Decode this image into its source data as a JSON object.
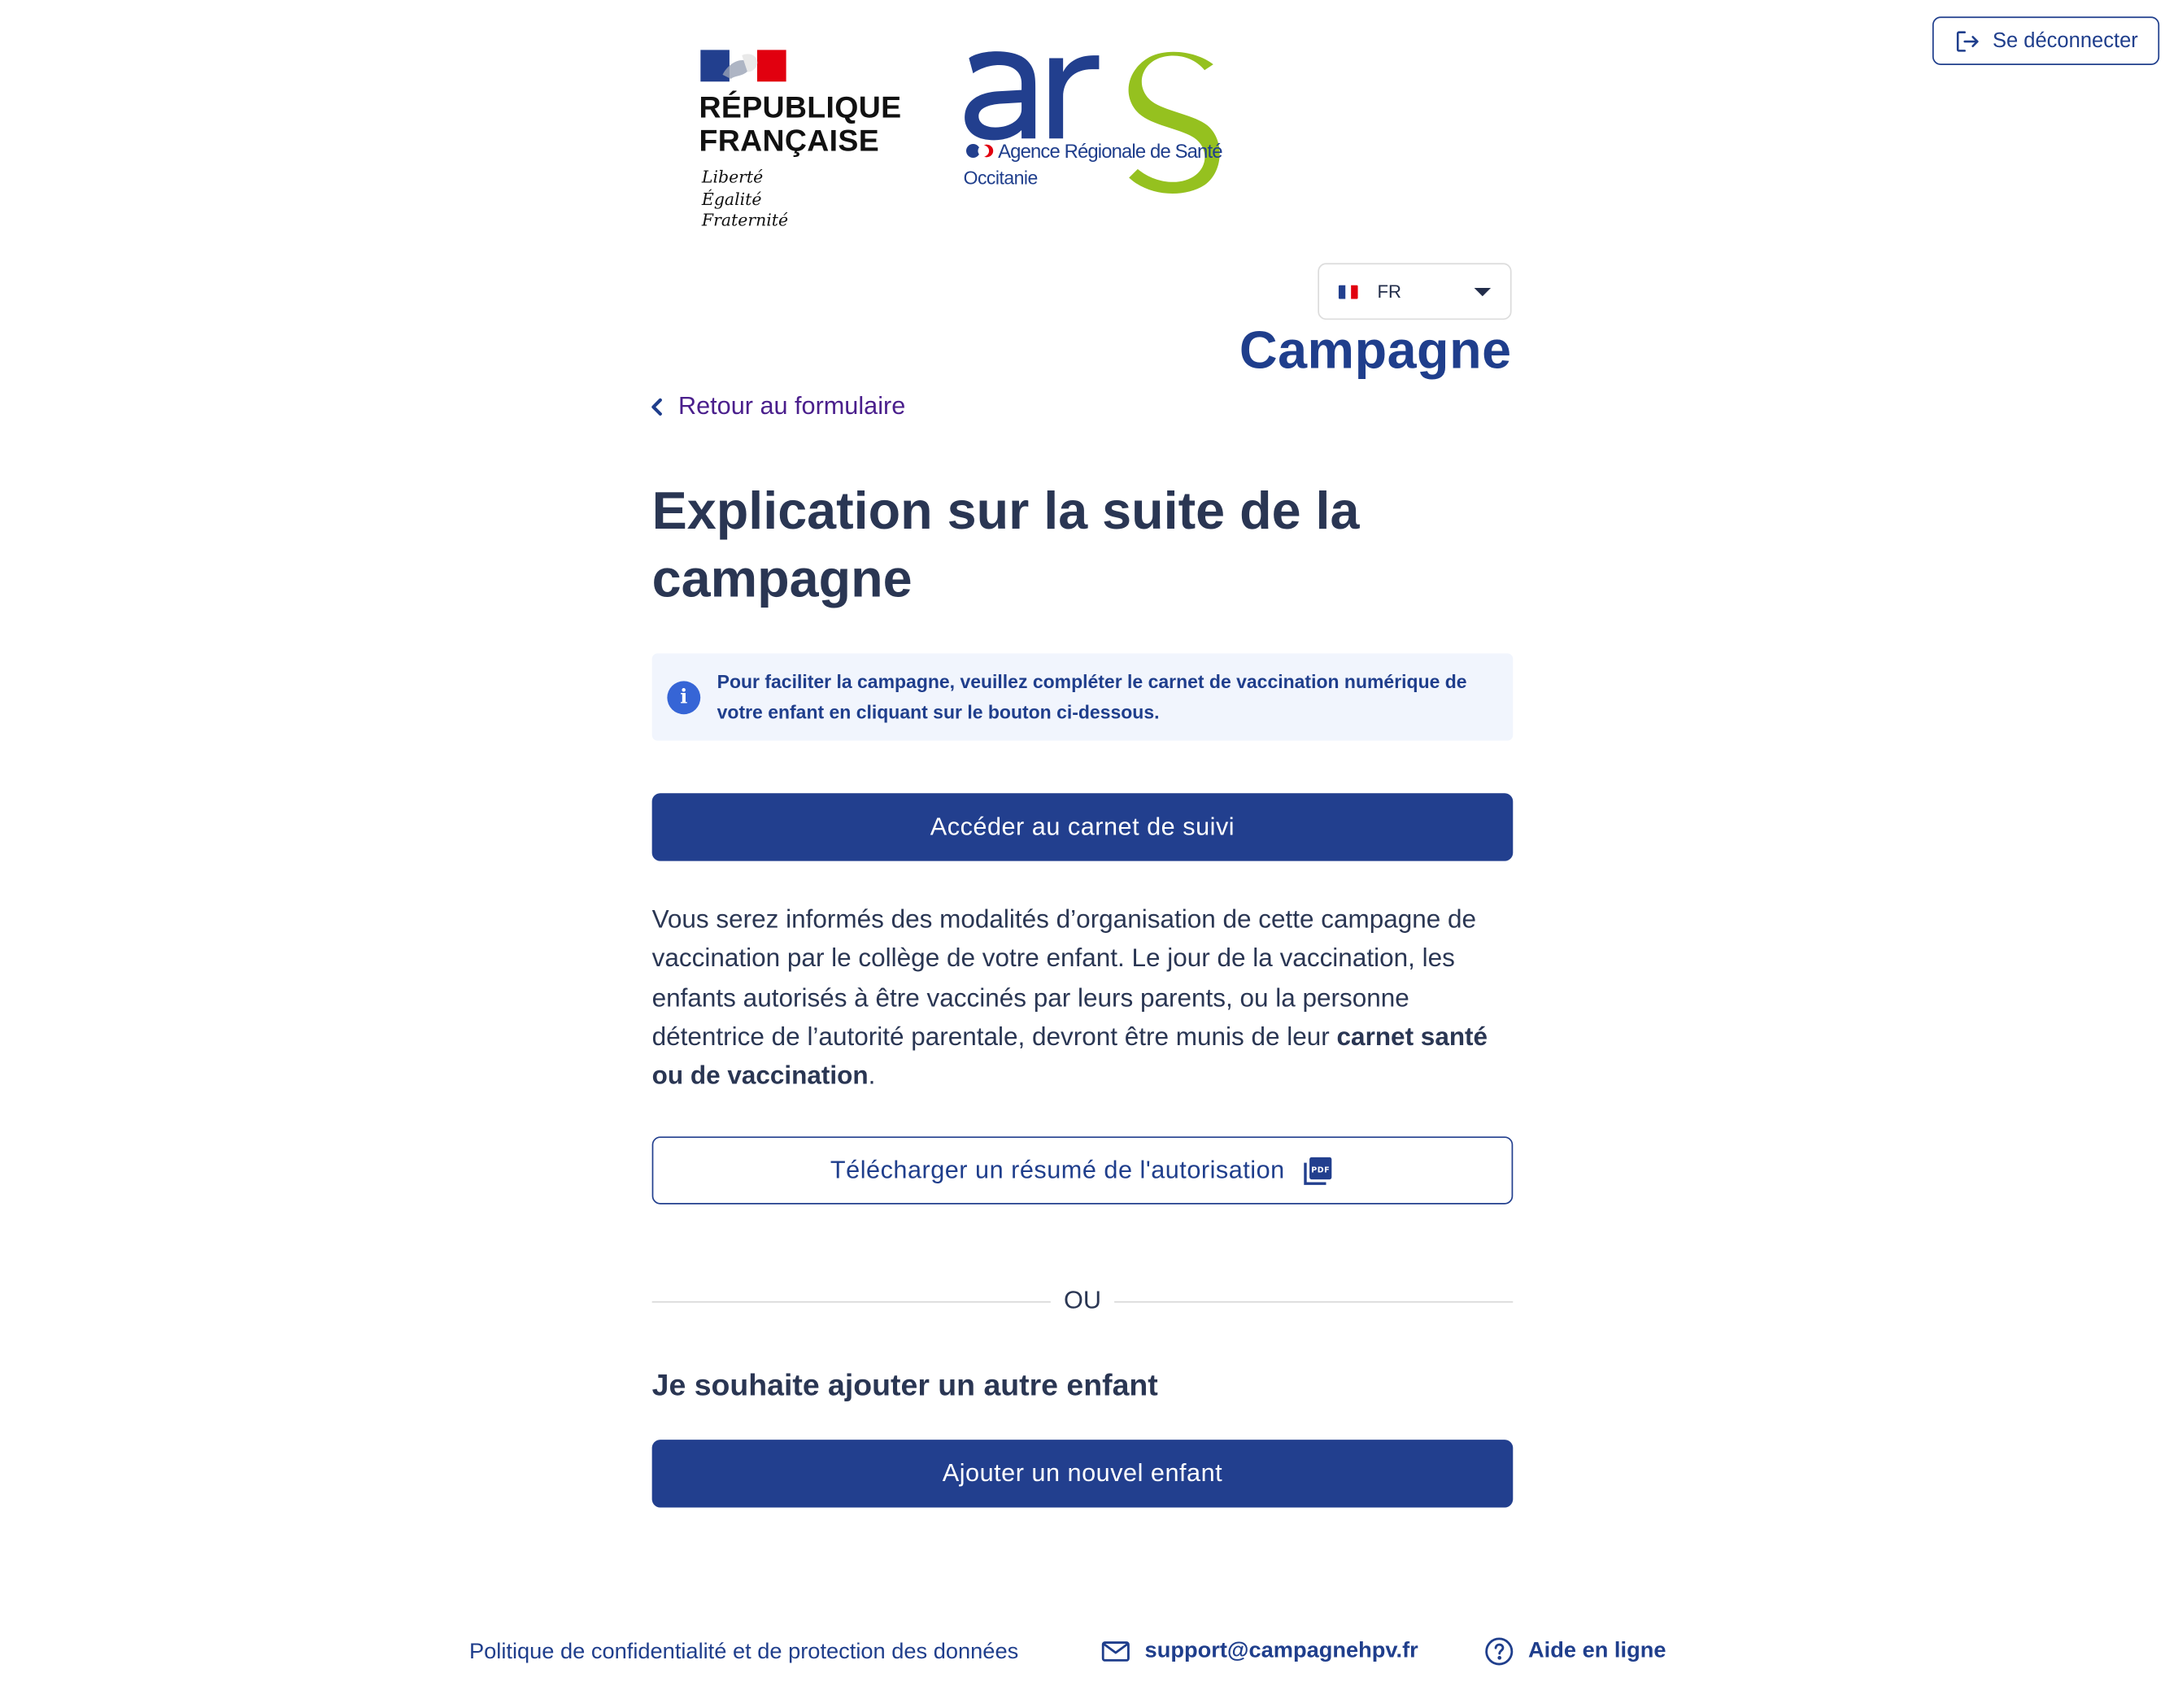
{
  "header": {
    "logout_label": "Se déconnecter"
  },
  "logos": {
    "rf_line1": "RÉPUBLIQUE",
    "rf_line2": "FRANÇAISE",
    "rf_motto1": "Liberté",
    "rf_motto2": "Égalité",
    "rf_motto3": "Fraternité",
    "ars_subtitle": "Agence Régionale de Santé",
    "ars_region": "Occitanie"
  },
  "language": {
    "selected": "FR"
  },
  "page": {
    "heading": "Campagne",
    "back_link": "Retour au formulaire",
    "title": "Explication sur la suite de la campagne",
    "info_text": "Pour faciliter la campagne, veuillez compléter le carnet de vaccination numérique de votre enfant en cliquant sur le bouton ci-dessous.",
    "access_button": "Accéder au carnet de suivi",
    "body_text": "Vous serez informés des modalités d’organisation de cette campagne de vaccination par le collège de votre enfant. Le jour de la vaccination, les enfants autorisés à être vaccinés par leurs parents, ou la personne détentrice de l’autorité parentale, devront être munis de leur ",
    "body_text_bold": "carnet santé ou de vaccination",
    "body_text_end": ".",
    "download_button": "Télécharger un résumé de l'autorisation",
    "divider_text": "OU",
    "add_child_heading": "Je souhaite ajouter un autre enfant",
    "add_child_button": "Ajouter un nouvel enfant"
  },
  "footer": {
    "privacy": "Politique de confidentialité et de protection des données",
    "email": "support@campagnehpv.fr",
    "help": "Aide en ligne"
  },
  "colors": {
    "primary": "#223f8e",
    "info_bg": "#f1f5fd",
    "ars_green": "#95c11f",
    "back_link": "#4a1f8c"
  }
}
